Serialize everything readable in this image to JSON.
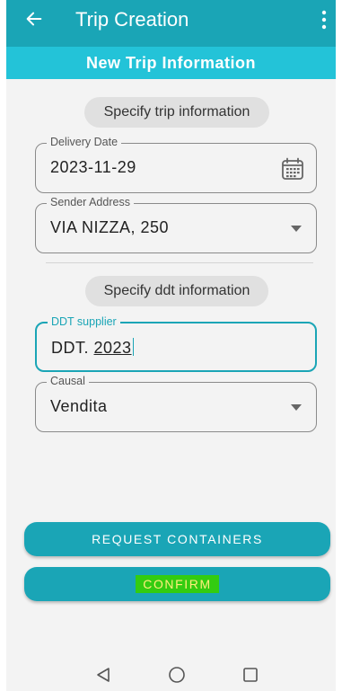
{
  "appbar": {
    "title": "Trip Creation",
    "back_icon": "arrow-left-icon",
    "menu_icon": "more-vert-icon"
  },
  "subheader": {
    "title": "New Trip Information"
  },
  "trip_section": {
    "chip": "Specify trip information",
    "delivery_date": {
      "label": "Delivery Date",
      "value": "2023-11-29",
      "icon": "calendar-icon"
    },
    "sender_address": {
      "label": "Sender Address",
      "value": "VIA NIZZA, 250",
      "icon": "dropdown-arrow-icon"
    }
  },
  "ddt_section": {
    "chip": "Specify ddt information",
    "ddt_supplier": {
      "label": "DDT supplier",
      "value_prefix": "DDT. ",
      "value_underlined": "2023"
    },
    "causal": {
      "label": "Causal",
      "value": "Vendita",
      "icon": "dropdown-arrow-icon"
    }
  },
  "buttons": {
    "request_containers": "REQUEST CONTAINERS",
    "confirm": "CONFIRM"
  },
  "navbar": {
    "back": "nav-back-icon",
    "home": "nav-home-icon",
    "recents": "nav-recents-icon"
  },
  "colors": {
    "appbar": "#1aa5b6",
    "subheader": "#23c3d8",
    "focused_border": "#1aa5b6",
    "confirm_highlight": "#33cc11"
  }
}
